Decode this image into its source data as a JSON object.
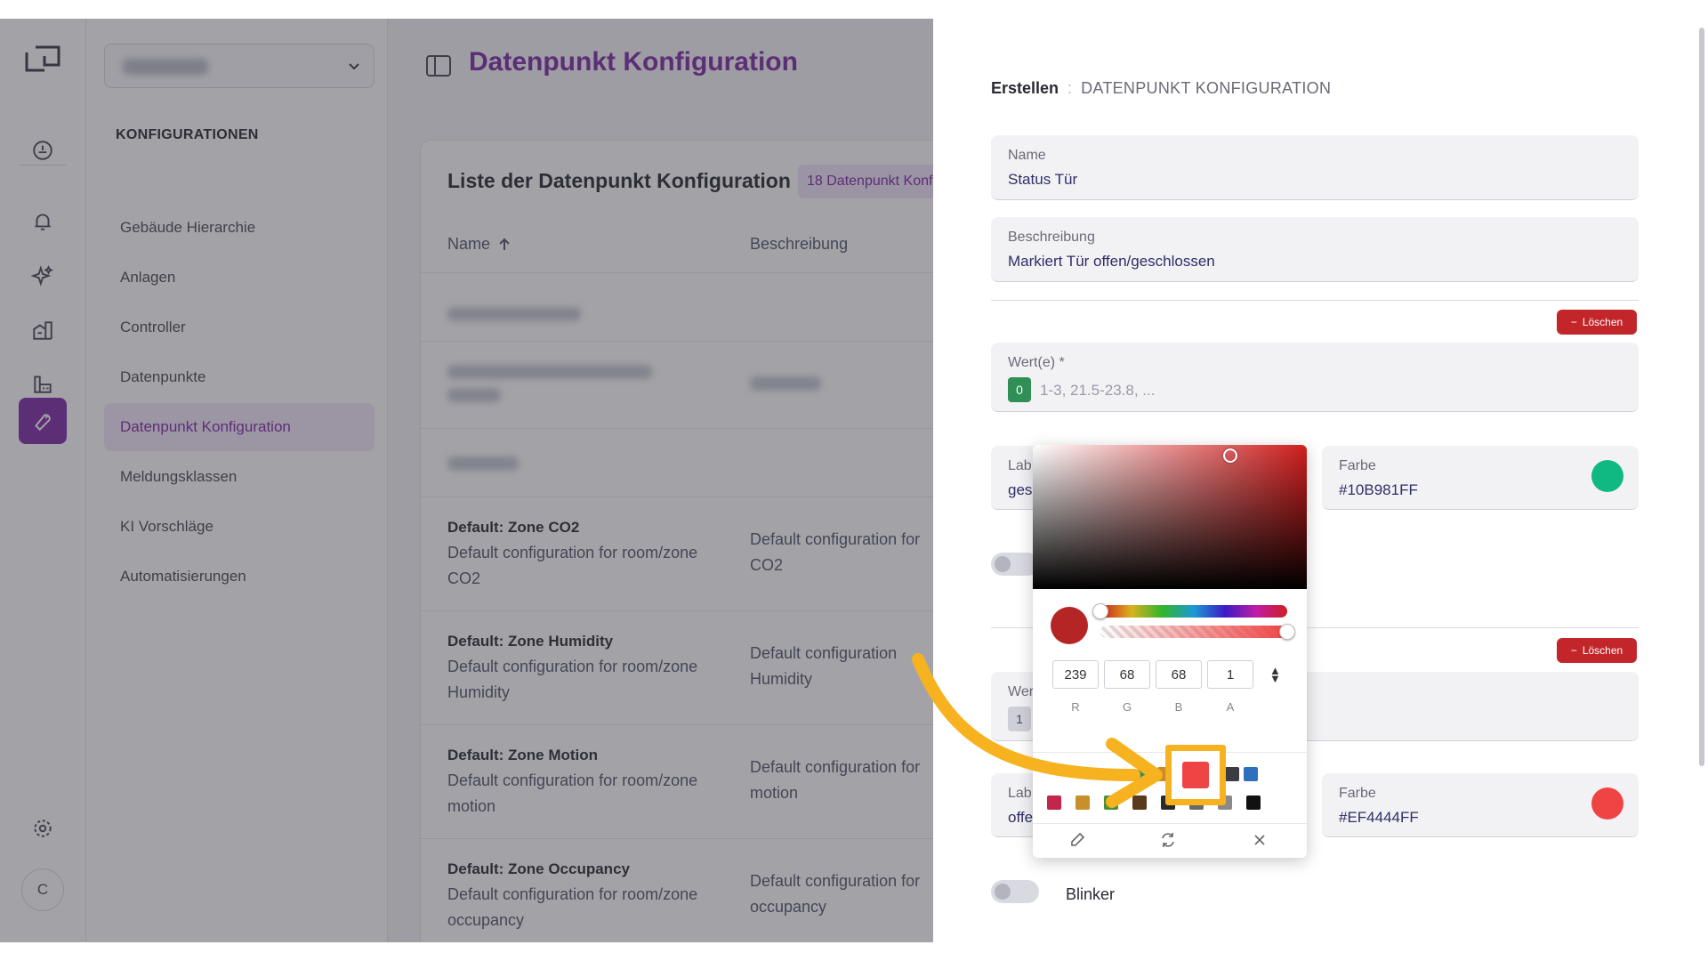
{
  "app": {
    "rail": {
      "icons": [
        "logo-icon",
        "dashboard-icon",
        "bell-icon",
        "sparkles-icon",
        "buildings-icon",
        "plant-icon",
        "wrench-icon",
        "gear-icon"
      ],
      "avatar_initial": "C"
    },
    "nav": {
      "section_title": "KONFIGURATIONEN",
      "items": [
        {
          "label": "Gebäude Hierarchie"
        },
        {
          "label": "Anlagen"
        },
        {
          "label": "Controller"
        },
        {
          "label": "Datenpunkte"
        },
        {
          "label": "Datenpunkt Konfiguration",
          "selected": true
        },
        {
          "label": "Meldungsklassen"
        },
        {
          "label": "KI Vorschläge"
        },
        {
          "label": "Automatisierungen"
        }
      ]
    }
  },
  "main": {
    "page_title": "Datenpunkt Konfiguration",
    "card_title": "Liste der Datenpunkt Konfiguration",
    "count_badge": "18 Datenpunkt Konf",
    "columns": {
      "name": "Name",
      "description": "Beschreibung"
    },
    "rows": [
      {
        "name": "Default: Zone CO2",
        "desc": "Default configuration for room/zone CO2",
        "desc2": "Default configuration for CO2"
      },
      {
        "name": "Default: Zone Humidity",
        "desc": "Default configuration for room/zone Humidity",
        "desc2": "Default configuration Humidity"
      },
      {
        "name": "Default: Zone Motion",
        "desc": "Default configuration for room/zone motion",
        "desc2": "Default configuration for motion"
      },
      {
        "name": "Default: Zone Occupancy",
        "desc": "Default configuration for room/zone occupancy",
        "desc2": "Default configuration for occupancy"
      }
    ]
  },
  "drawer": {
    "breadcrumb": {
      "current": "Erstellen",
      "parent": "DATENPUNKT KONFIGURATION"
    },
    "name": {
      "label": "Name",
      "value": "Status Tür"
    },
    "description": {
      "label": "Beschreibung",
      "value": "Markiert Tür offen/geschlossen"
    },
    "delete_label": "Löschen",
    "value_group_1": {
      "values_label": "Wert(e) *",
      "chip": "0",
      "placeholder": "1-3, 21.5-23.8, ...",
      "label_label": "Lab",
      "label_value": "ges",
      "color_label": "Farbe",
      "color_value": "#10B981FF",
      "color_hex": "#10B981"
    },
    "value_group_2": {
      "values_label": "Wer",
      "chip": "1",
      "label_label": "Lab",
      "label_value": "offe",
      "color_label": "Farbe",
      "color_value": "#EF4444FF",
      "color_hex": "#EF4444"
    },
    "blinker_label": "Blinker"
  },
  "color_picker": {
    "r": "239",
    "g": "68",
    "b": "68",
    "a": "1",
    "labels": {
      "r": "R",
      "g": "G",
      "b": "B",
      "a": "A"
    },
    "preview_color": "#b52525",
    "swatches_row1": [
      "#2f8f57",
      "#c88a2a",
      "#ef4444",
      "#3b3b44",
      "#2f6fbf"
    ],
    "swatches_row2": [
      "#c2264a",
      "#c8902a",
      "#4a8f3a",
      "#5a3a1a",
      "#2a2a2a",
      "#6a6a6a",
      "#8a8a8a",
      "#111111"
    ],
    "highlighted_swatch": "#ef4444",
    "tools": [
      "eyedropper-icon",
      "refresh-icon",
      "close-icon"
    ]
  }
}
